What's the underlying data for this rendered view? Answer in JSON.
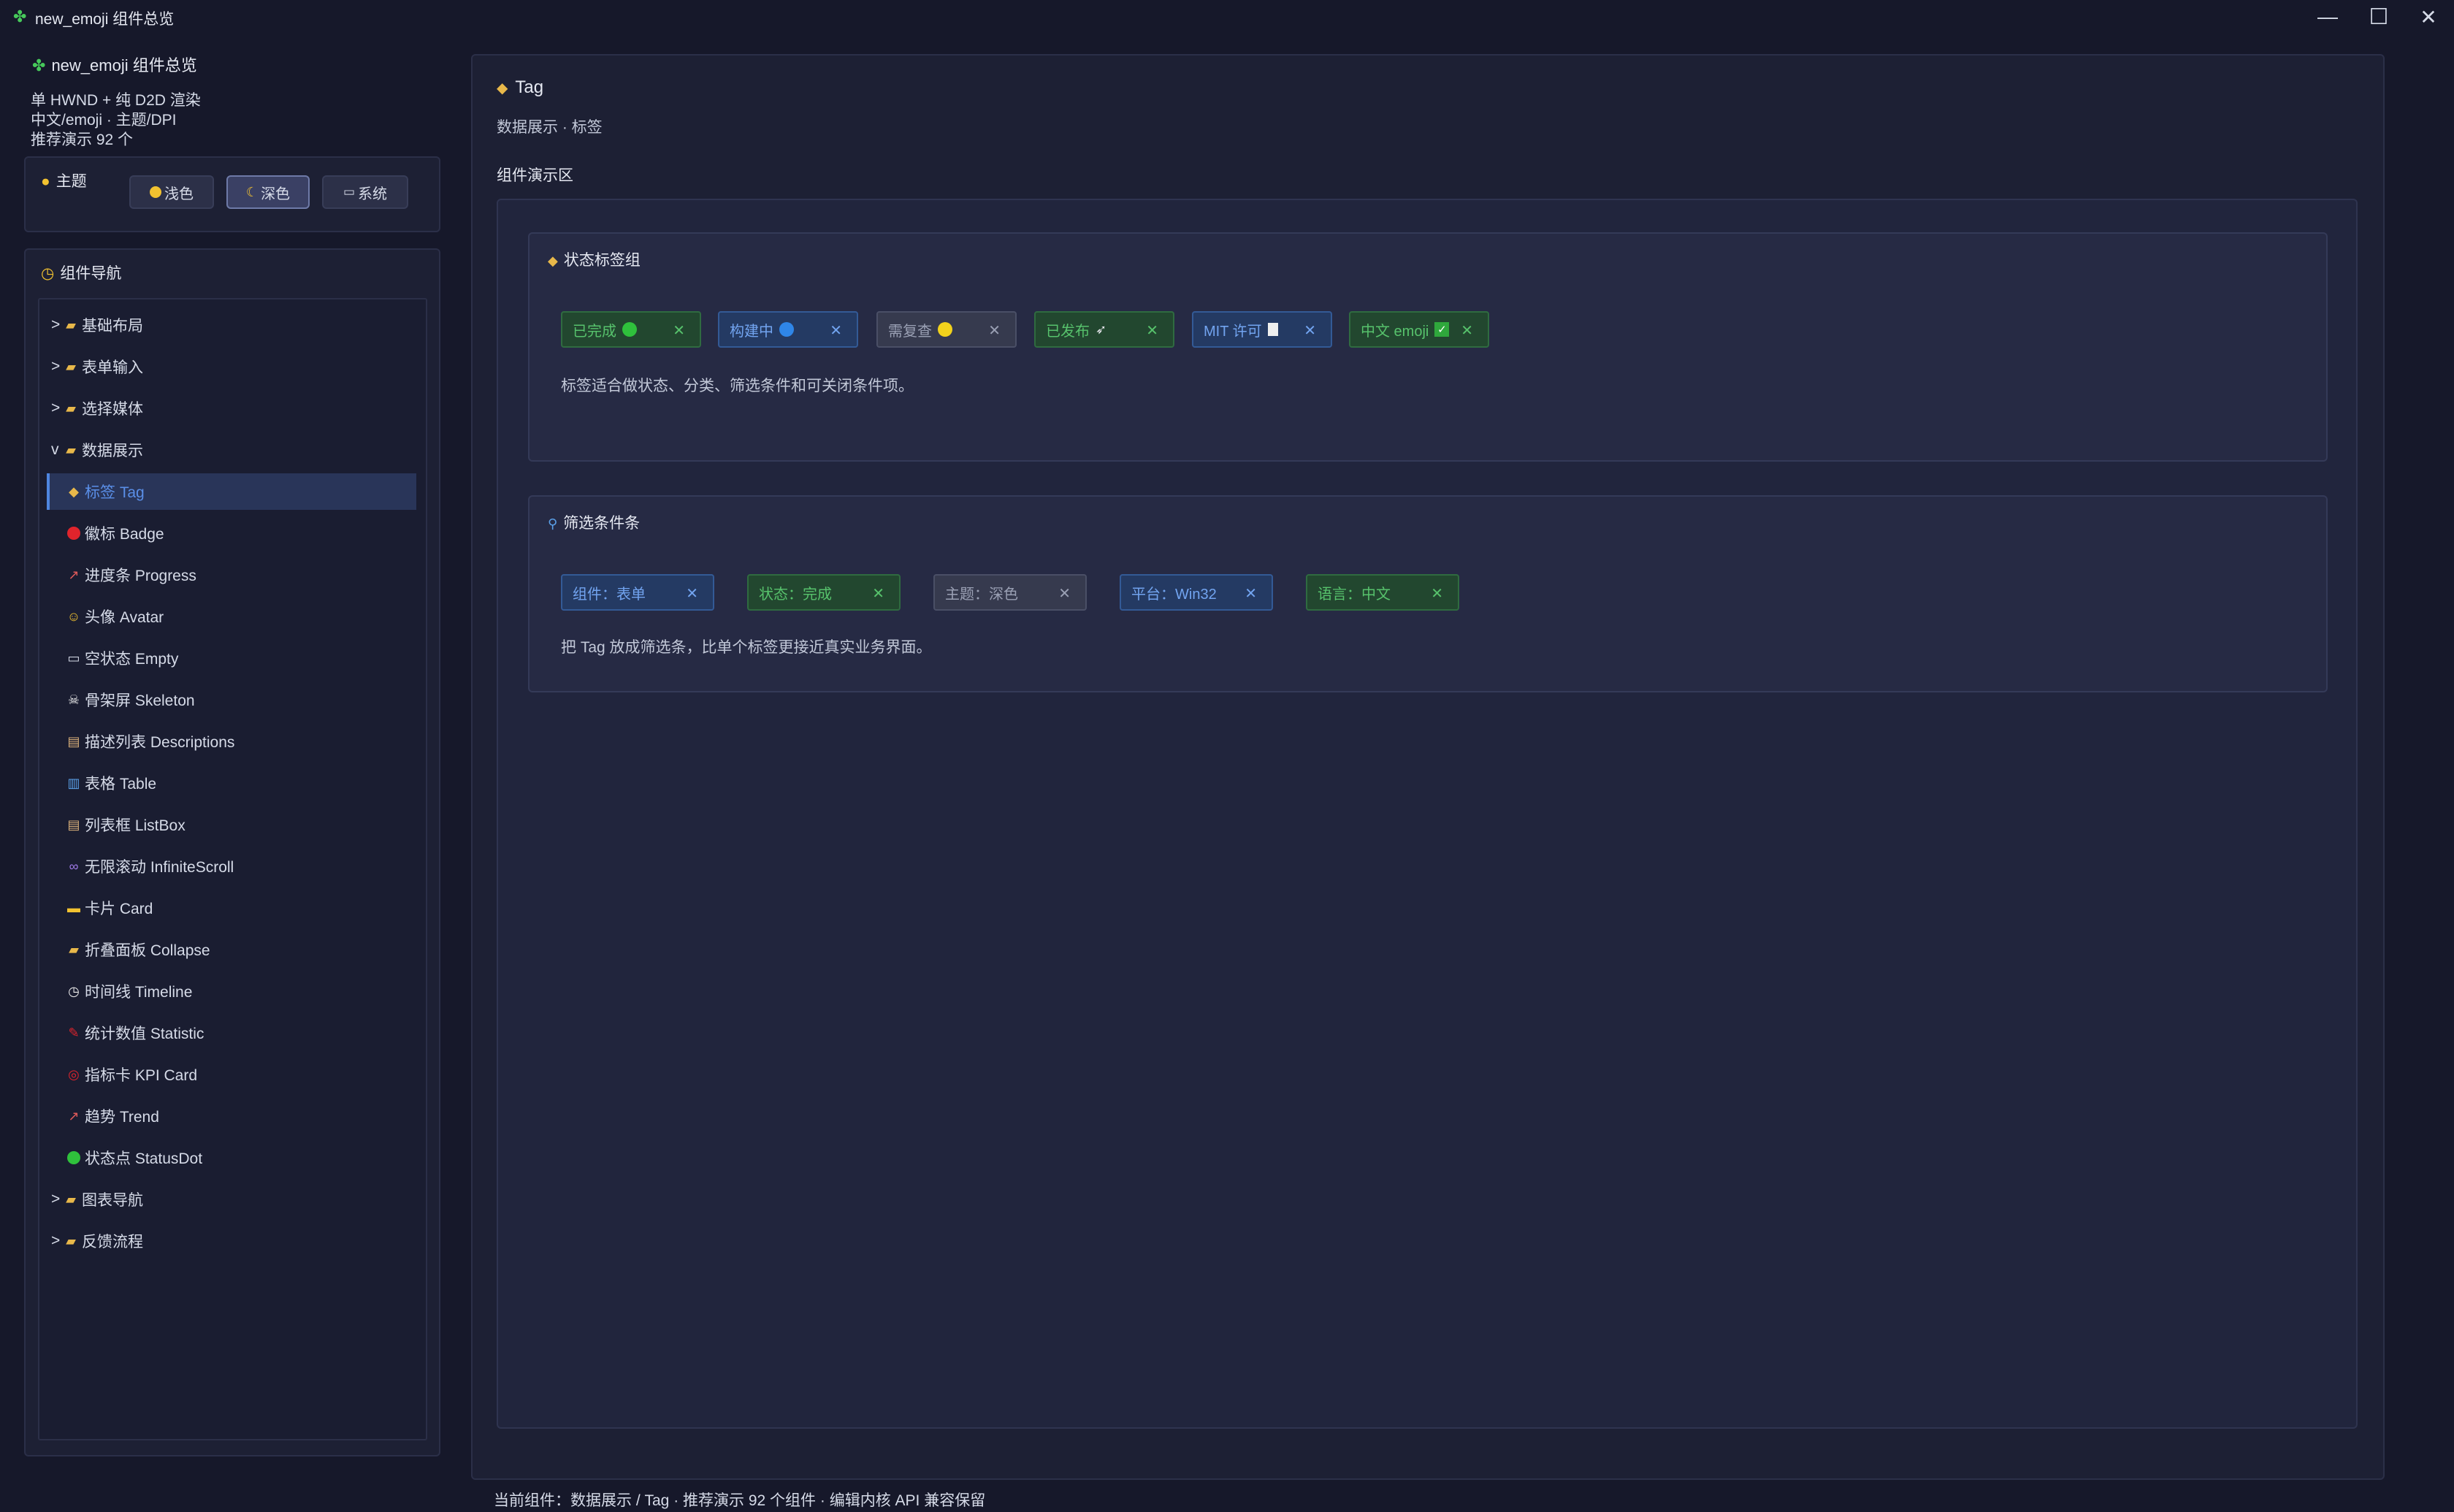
{
  "window": {
    "title": "new_emoji 组件总览",
    "controls": {
      "minimize": "—",
      "maximize": "☐",
      "close": "✕"
    }
  },
  "sidebar": {
    "title": "new_emoji 组件总览",
    "info": [
      "单 HWND + 纯 D2D 渲染",
      "中文/emoji · 主题/DPI",
      "推荐演示 92 个"
    ],
    "theme": {
      "label": "主题",
      "options": [
        {
          "label": "浅色",
          "icon": "sun-icon"
        },
        {
          "label": "深色",
          "icon": "moon-icon",
          "active": true
        },
        {
          "label": "系统",
          "icon": "laptop-icon"
        }
      ]
    },
    "nav": {
      "title": "组件导航",
      "items": [
        {
          "prefix": ">",
          "label": "基础布局",
          "icon": "folder-icon",
          "group": true
        },
        {
          "prefix": ">",
          "label": "表单输入",
          "icon": "folder-icon",
          "group": true
        },
        {
          "prefix": ">",
          "label": "选择媒体",
          "icon": "folder-icon",
          "group": true
        },
        {
          "prefix": "v",
          "label": "数据展示",
          "icon": "folder-icon",
          "group": true
        },
        {
          "label": "标签 Tag",
          "icon": "tag-icon",
          "selected": true
        },
        {
          "label": "徽标 Badge",
          "icon": "red-circle-icon"
        },
        {
          "label": "进度条 Progress",
          "icon": "chart-up-icon"
        },
        {
          "label": "头像 Avatar",
          "icon": "smiley-icon"
        },
        {
          "label": "空状态 Empty",
          "icon": "inbox-icon"
        },
        {
          "label": "骨架屏 Skeleton",
          "icon": "skull-icon"
        },
        {
          "label": "描述列表 Descriptions",
          "icon": "clipboard-icon"
        },
        {
          "label": "表格 Table",
          "icon": "bar-chart-icon"
        },
        {
          "label": "列表框 ListBox",
          "icon": "clipboard-icon"
        },
        {
          "label": "无限滚动 InfiniteScroll",
          "icon": "infinity-icon"
        },
        {
          "label": "卡片 Card",
          "icon": "card-icon"
        },
        {
          "label": "折叠面板 Collapse",
          "icon": "folder-icon"
        },
        {
          "label": "时间线 Timeline",
          "icon": "clock-icon"
        },
        {
          "label": "统计数值 Statistic",
          "icon": "pushpin-icon"
        },
        {
          "label": "指标卡 KPI Card",
          "icon": "target-icon"
        },
        {
          "label": "趋势 Trend",
          "icon": "chart-up-icon"
        },
        {
          "label": "状态点 StatusDot",
          "icon": "green-circle-icon"
        },
        {
          "prefix": ">",
          "label": "图表导航",
          "icon": "folder-icon",
          "group": true
        },
        {
          "prefix": ">",
          "label": "反馈流程",
          "icon": "folder-icon",
          "group": true
        }
      ]
    }
  },
  "main": {
    "title": "Tag",
    "subtitle": "数据展示 · 标签",
    "demo_label": "组件演示区",
    "cards": [
      {
        "title": "状态标签组",
        "icon": "tag-icon",
        "tags": [
          {
            "label": "已完成",
            "style": "green",
            "emoji": "green-circle-icon"
          },
          {
            "label": "构建中",
            "style": "blue",
            "emoji": "blue-circle-icon"
          },
          {
            "label": "需复查",
            "style": "gray",
            "emoji": "yellow-circle-icon"
          },
          {
            "label": "已发布",
            "style": "green",
            "emoji": "rocket-icon"
          },
          {
            "label": "MIT 许可",
            "style": "blue",
            "emoji": "document-icon"
          },
          {
            "label": "中文 emoji",
            "style": "green",
            "emoji": "check-box-icon"
          }
        ],
        "desc": "标签适合做状态、分类、筛选条件和可关闭条件项。"
      },
      {
        "title": "筛选条件条",
        "icon": "magnifier-icon",
        "tags": [
          {
            "label": "组件：表单",
            "style": "blue"
          },
          {
            "label": "状态：完成",
            "style": "green"
          },
          {
            "label": "主题：深色",
            "style": "gray"
          },
          {
            "label": "平台：Win32",
            "style": "blue"
          },
          {
            "label": "语言：中文",
            "style": "green"
          }
        ],
        "desc": "把 Tag 放成筛选条，比单个标签更接近真实业务界面。"
      }
    ]
  },
  "footer": "当前组件：数据展示 / Tag · 推荐演示 92 个组件 · 编辑内核 API 兼容保留",
  "colors": {
    "background": "#16182a",
    "accent": "#4e86e0",
    "tag_green": "#57c26c",
    "tag_blue": "#72a4f0",
    "tag_gray": "#9aa0b4"
  }
}
